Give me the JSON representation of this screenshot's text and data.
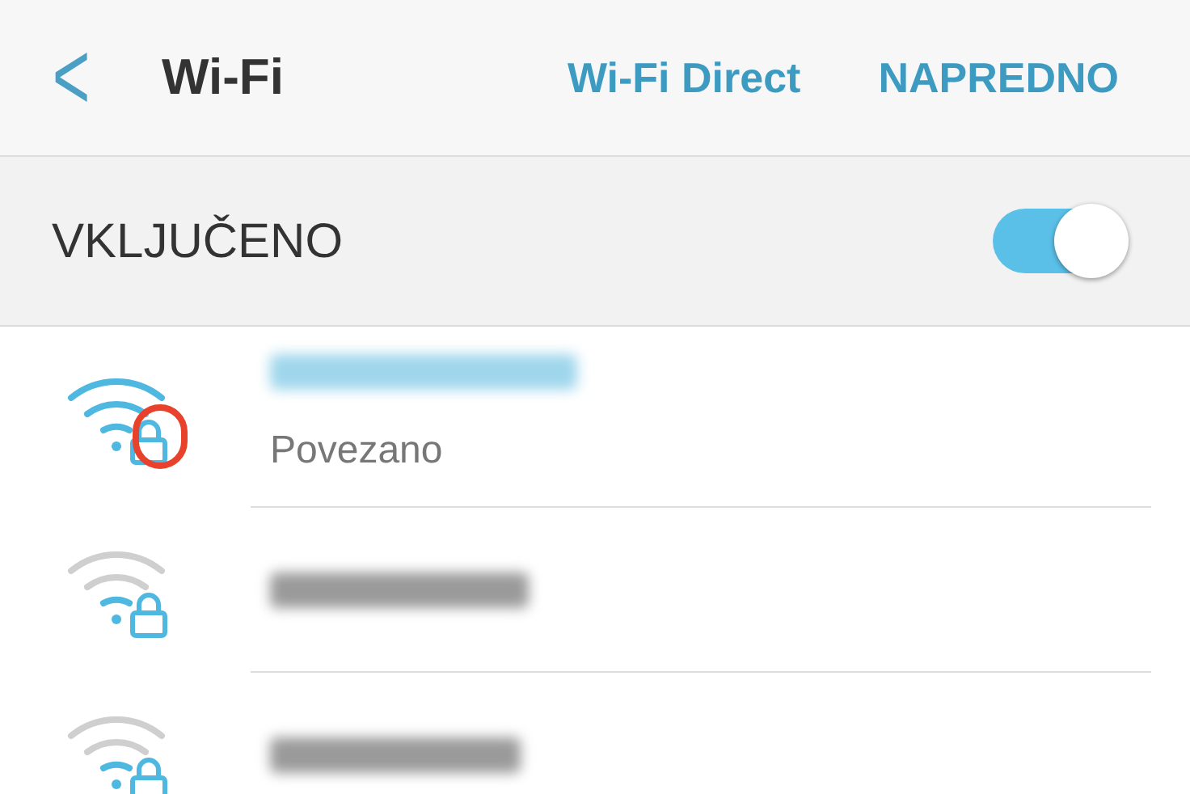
{
  "header": {
    "back": "<",
    "title": "Wi-Fi",
    "actions": [
      "Wi-Fi Direct",
      "NAPREDNO"
    ]
  },
  "master": {
    "label": "VKLJUČENO",
    "on": true
  },
  "networks": [
    {
      "status": "Povezano",
      "connected": true,
      "secured": true,
      "highlighted": true
    },
    {
      "connected": false,
      "secured": true,
      "highlighted": false
    },
    {
      "connected": false,
      "secured": true,
      "highlighted": false
    }
  ]
}
